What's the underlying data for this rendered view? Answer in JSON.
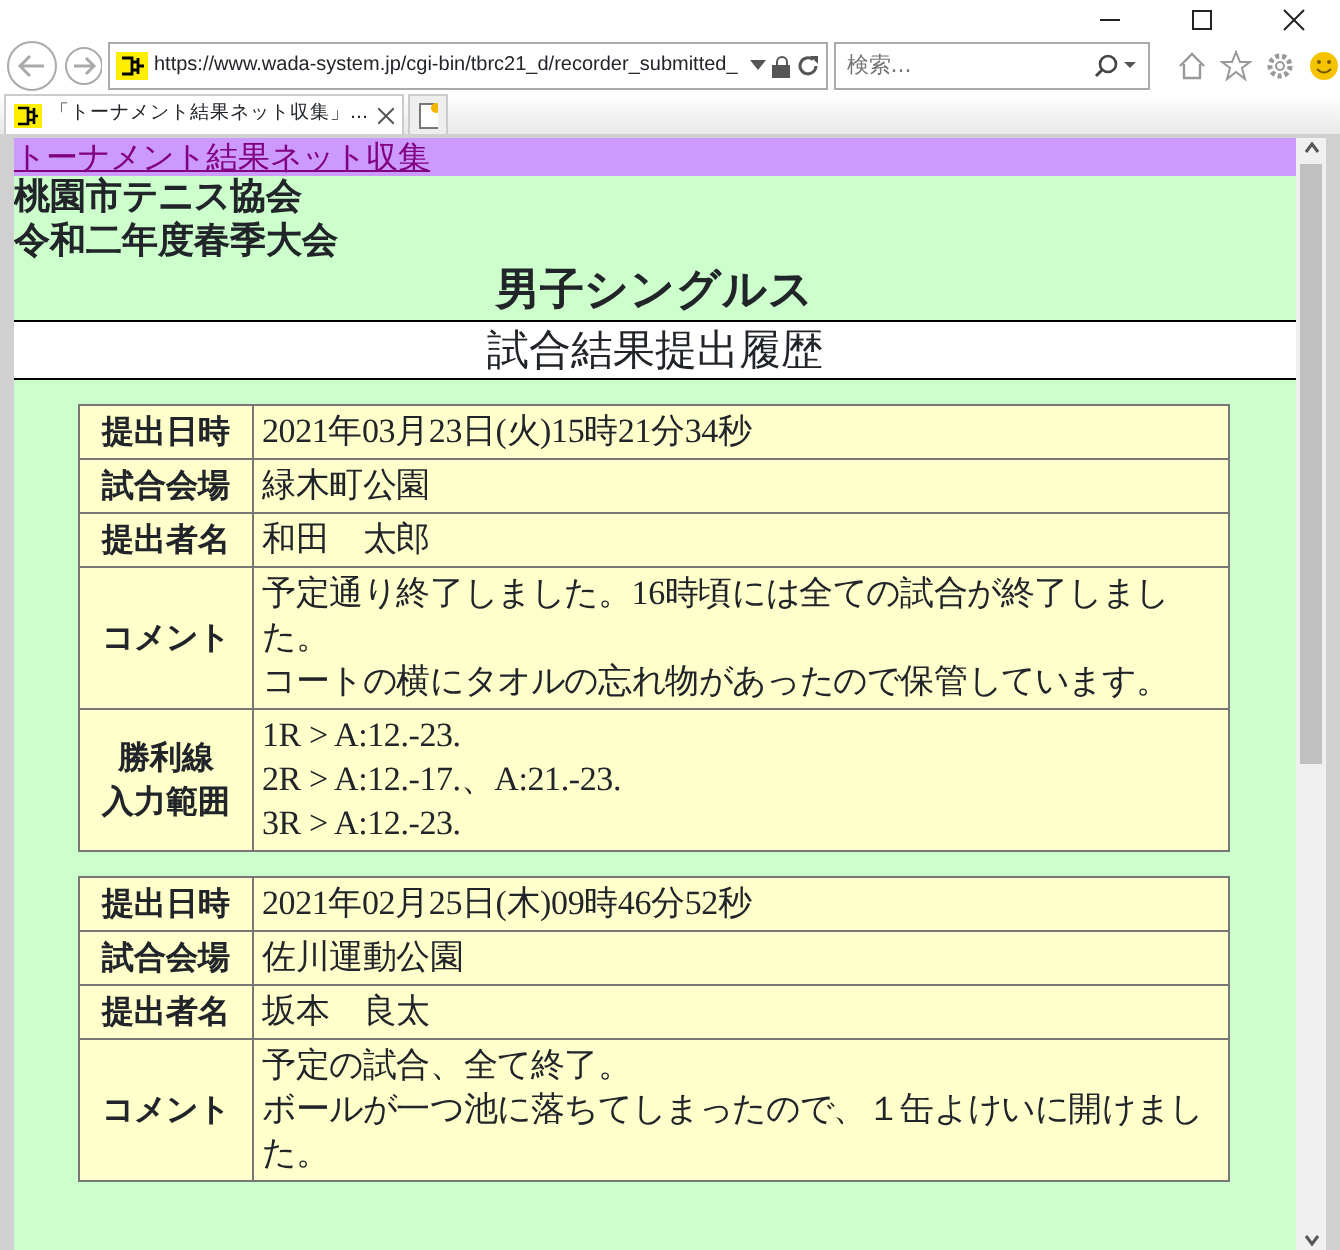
{
  "address_bar": {
    "url": "https://www.wada-system.jp/cgi-bin/tbrc21_d/recorder_submitted_"
  },
  "search": {
    "placeholder": "検索..."
  },
  "tabs": [
    {
      "label": "「トーナメント結果ネット収集」...",
      "selected": true
    }
  ],
  "page": {
    "link": "トーナメント結果ネット収集",
    "org": "桃園市テニス協会",
    "tournament": "令和二年度春季大会",
    "event": "男子シングルス",
    "heading": "試合結果提出履歴",
    "records": [
      {
        "rows": [
          {
            "label": [
              "提出日時"
            ],
            "value": [
              "2021年03月23日(火)15時21分34秒"
            ]
          },
          {
            "label": [
              "試合会場"
            ],
            "value": [
              "緑木町公園"
            ]
          },
          {
            "label": [
              "提出者名"
            ],
            "value": [
              "和田　太郎"
            ]
          },
          {
            "label": [
              "コメント"
            ],
            "value": [
              "予定通り終了しました。16時頃には全ての試合が終了しました。",
              "コートの横にタオルの忘れ物があったので保管しています。"
            ]
          },
          {
            "label": [
              "勝利線",
              "入力範囲"
            ],
            "value": [
              "1R > A:12.-23.",
              "2R > A:12.-17.、A:21.-23.",
              "3R > A:12.-23."
            ]
          }
        ]
      },
      {
        "rows": [
          {
            "label": [
              "提出日時"
            ],
            "value": [
              "2021年02月25日(木)09時46分52秒"
            ]
          },
          {
            "label": [
              "試合会場"
            ],
            "value": [
              "佐川運動公園"
            ]
          },
          {
            "label": [
              "提出者名"
            ],
            "value": [
              "坂本　良太"
            ]
          },
          {
            "label": [
              "コメント"
            ],
            "value": [
              "予定の試合、全て終了。",
              "ボールが一つ池に落ちてしまったので、１缶よけいに開けました。"
            ]
          }
        ]
      }
    ]
  }
}
